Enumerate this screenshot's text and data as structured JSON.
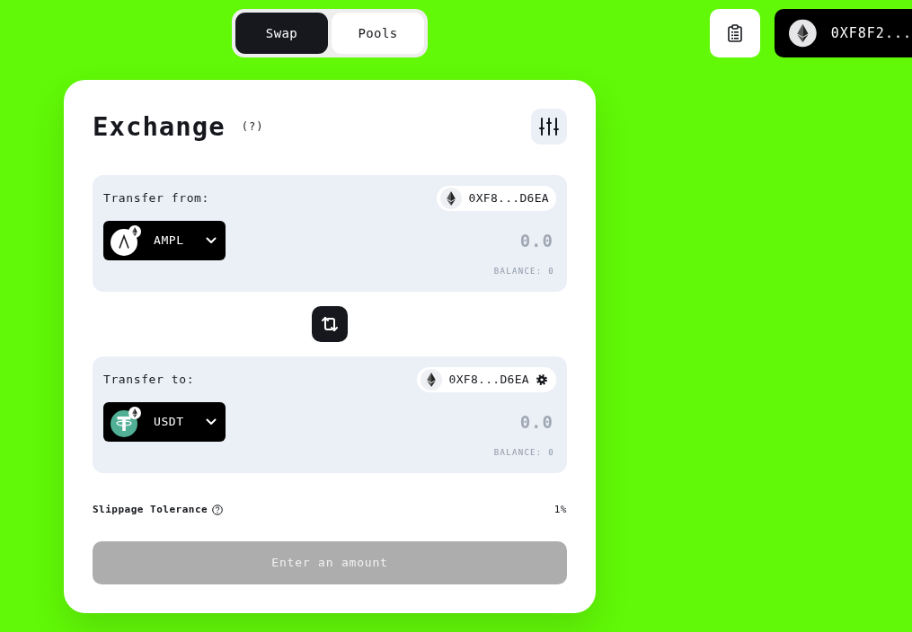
{
  "nav": {
    "tabs": [
      {
        "label": "Swap",
        "selected": true
      },
      {
        "label": "Pools",
        "selected": false
      }
    ]
  },
  "header": {
    "wallet": {
      "address": "0XF8F2..."
    }
  },
  "exchange": {
    "title": "Exchange",
    "help": "(?)",
    "panels": [
      {
        "label": "Transfer from:",
        "address": "0XF8...D6EA",
        "settings_icon": false,
        "token": {
          "symbol": "AMPL",
          "kind": "ampl"
        },
        "amount": {
          "placeholder": "0.0"
        },
        "balance": "BALANCE: 0"
      },
      {
        "label": "Transfer to:",
        "address": "0XF8...D6EA",
        "settings_icon": true,
        "token": {
          "symbol": "USDT",
          "kind": "usdt"
        },
        "amount": {
          "placeholder": "0.0"
        },
        "balance": "BALANCE: 0"
      }
    ],
    "slippage": {
      "label": "Slippage Tolerance",
      "value": "1%"
    },
    "submit": {
      "label": "Enter an amount",
      "disabled": true
    }
  }
}
